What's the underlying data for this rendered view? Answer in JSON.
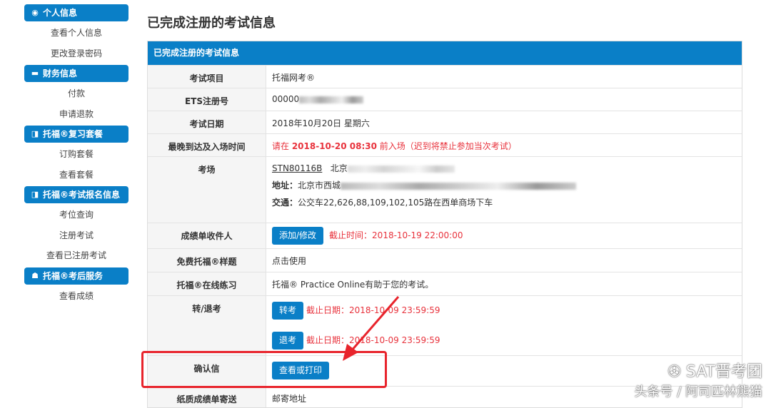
{
  "sidebar": [
    {
      "title": "个人信息",
      "icon": "user-circle-icon",
      "items": [
        "查看个人信息",
        "更改登录密码"
      ]
    },
    {
      "title": "财务信息",
      "icon": "credit-card-icon",
      "items": [
        "付款",
        "申请退款"
      ]
    },
    {
      "title": "托福®复习套餐",
      "icon": "book-icon",
      "items": [
        "订购套餐",
        "查看套餐"
      ]
    },
    {
      "title": "托福®考试报名信息",
      "icon": "book-icon",
      "items": [
        "考位查询",
        "注册考试",
        "查看已注册考试"
      ]
    },
    {
      "title": "托福®考后服务",
      "icon": "hand-icon",
      "items": [
        "查看成绩"
      ]
    }
  ],
  "page_title": "已完成注册的考试信息",
  "panel_title": "已完成注册的考试信息",
  "rows": {
    "item": {
      "label": "考试项目",
      "value": "托福网考®"
    },
    "ets": {
      "label": "ETS注册号",
      "value": "00000"
    },
    "date": {
      "label": "考试日期",
      "value": "2018年10月20日 星期六"
    },
    "arrival": {
      "label": "最晚到达及入场时间",
      "pre": "请在 ",
      "time": "2018-10-20 08:30",
      "post": " 前入场（迟到将禁止参加当次考试）"
    },
    "venue": {
      "label": "考场",
      "code": "STN80116B",
      "city": "北京",
      "addr_label": "地址：",
      "addr": "北京市西城",
      "traffic_label": "交通：",
      "traffic": "公交车22,626,88,109,102,105路在西单商场下车"
    },
    "recipient": {
      "label": "成绩单收件人",
      "button": "添加/修改",
      "deadline": "截止时间：2018-10-19 22:00:00"
    },
    "sample": {
      "label": "免费托福®样题",
      "value": "点击使用"
    },
    "practice": {
      "label": "托福®在线练习",
      "value": "托福® Practice Online有助于您的考试。"
    },
    "transfer": {
      "label": "转/退考",
      "transfer_button": "转考",
      "transfer_deadline": "截止日期：2018-10-09 23:59:59",
      "cancel_button": "退考",
      "cancel_deadline": "截止日期：2018-10-09 23:59:59"
    },
    "confirm": {
      "label": "确认信",
      "button": "查看或打印"
    },
    "mail": {
      "label": "纸质成绩单寄送",
      "value": "邮寄地址"
    }
  },
  "watermark": {
    "line1": "SAT晋考团",
    "line2": "头条号 / 阿司匹林熊猫"
  },
  "colors": {
    "accent": "#0a7fc7",
    "warning": "#e8323c"
  }
}
